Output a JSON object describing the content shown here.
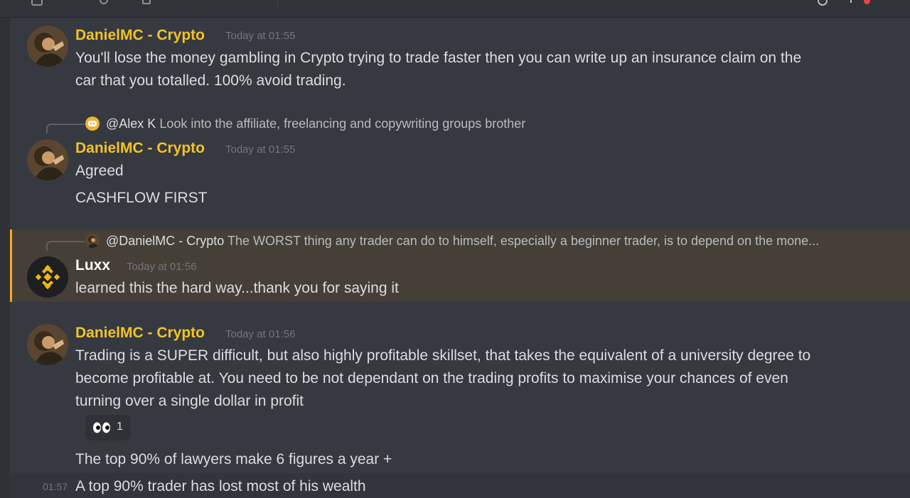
{
  "colors": {
    "background": "#36393f",
    "username": "#f0c32a",
    "highlight": "#453f37",
    "highlight_bar": "#faa61a",
    "timestamp": "#72767d"
  },
  "messages": [
    {
      "author": "DanielMC - Crypto",
      "timestamp": "Today at 01:55",
      "avatar": "danielmc-avatar",
      "lines": [
        "You'll lose the money gambling in Crypto trying to trade faster then you can write up an insurance claim on the",
        "car that you totalled. 100% avoid trading."
      ]
    },
    {
      "reply": {
        "icon": "discord-icon",
        "mention": "@Alex K",
        "text": "Look into the affiliate, freelancing and copywriting groups brother"
      },
      "author": "DanielMC - Crypto",
      "timestamp": "Today at 01:55",
      "avatar": "danielmc-avatar",
      "lines": [
        "Agreed",
        "CASHFLOW FIRST"
      ]
    },
    {
      "reply": {
        "icon": "danielmc-avatar",
        "mention": "@DanielMC - Crypto",
        "text": "The WORST thing any trader can do to himself, especially a beginner trader, is to depend on the mone..."
      },
      "author": "Luxx",
      "timestamp": "Today at 01:56",
      "avatar": "binance-logo-avatar",
      "lines": [
        "learned this the hard way...thank you for saying it"
      ]
    },
    {
      "author": "DanielMC - Crypto",
      "timestamp": "Today at 01:56",
      "avatar": "danielmc-avatar",
      "lines": [
        "Trading is a SUPER difficult, but also highly profitable skillset, that takes the equivalent of a university degree to",
        "become profitable at. You need to be not dependant on the trading profits to maximise your chances of even",
        "turning over a single dollar in profit"
      ],
      "reaction": {
        "emoji": "eyes-emoji",
        "count": "1"
      },
      "followups": [
        {
          "text": "The top 90% of lawyers make 6 figures a year +"
        },
        {
          "time": "01:57",
          "text": "A top 90% trader has lost most of his wealth"
        }
      ]
    }
  ]
}
